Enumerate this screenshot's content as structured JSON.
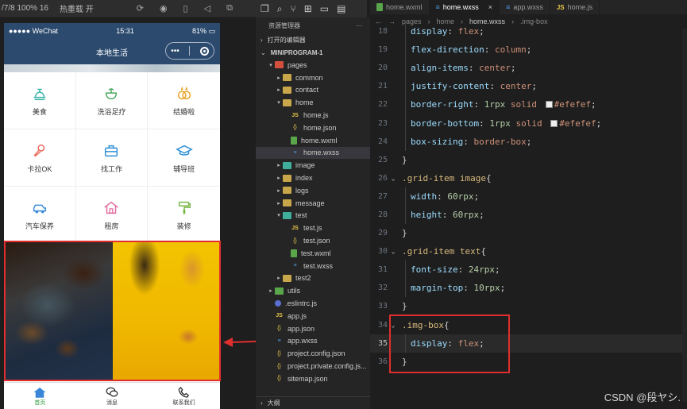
{
  "toolbar": {
    "device": "/7/8 100% 16",
    "hot_reload": "热重载 开"
  },
  "phone": {
    "status": {
      "carrier": "●●●●● WeChat",
      "time": "15:31",
      "battery": "81%"
    },
    "nav_title": "本地生活",
    "capsule_more": "•••",
    "grid": [
      {
        "label": "美食",
        "icon": "food-icon",
        "color": "#3cb4a8"
      },
      {
        "label": "洗浴足疗",
        "icon": "bath-icon",
        "color": "#4fa860"
      },
      {
        "label": "结婚啦",
        "icon": "rings-icon",
        "color": "#e8a428"
      },
      {
        "label": "卡拉OK",
        "icon": "microphone-icon",
        "color": "#e86a5a"
      },
      {
        "label": "找工作",
        "icon": "briefcase-icon",
        "color": "#2f8fd6"
      },
      {
        "label": "辅导班",
        "icon": "graduation-cap-icon",
        "color": "#2f8fd6"
      },
      {
        "label": "汽车保养",
        "icon": "car-icon",
        "color": "#3a8cd9"
      },
      {
        "label": "租房",
        "icon": "house-icon",
        "color": "#e26aa0"
      },
      {
        "label": "装修",
        "icon": "paint-roller-icon",
        "color": "#7ab648"
      }
    ],
    "tabs": [
      {
        "label": "首页",
        "icon": "home-icon",
        "active": true
      },
      {
        "label": "消息",
        "icon": "message-icon",
        "active": false
      },
      {
        "label": "联系我们",
        "icon": "phone-icon",
        "active": false
      }
    ]
  },
  "explorer": {
    "title": "资源管理器",
    "more": "···",
    "open_editors": "打开的编辑器",
    "project": "MINIPROGRAM-1",
    "outline": "大纲",
    "tree": [
      {
        "name": "pages",
        "depth": 1,
        "type": "folder-red",
        "chev": "▾"
      },
      {
        "name": "common",
        "depth": 2,
        "type": "folder",
        "chev": "▸"
      },
      {
        "name": "contact",
        "depth": 2,
        "type": "folder",
        "chev": "▸"
      },
      {
        "name": "home",
        "depth": 2,
        "type": "folder",
        "chev": "▾"
      },
      {
        "name": "home.js",
        "depth": 3,
        "type": "js",
        "chev": ""
      },
      {
        "name": "home.json",
        "depth": 3,
        "type": "json",
        "chev": ""
      },
      {
        "name": "home.wxml",
        "depth": 3,
        "type": "wxml",
        "chev": ""
      },
      {
        "name": "home.wxss",
        "depth": 3,
        "type": "wxss",
        "chev": "",
        "selected": true
      },
      {
        "name": "image",
        "depth": 2,
        "type": "folder-teal",
        "chev": "▸"
      },
      {
        "name": "index",
        "depth": 2,
        "type": "folder",
        "chev": "▸"
      },
      {
        "name": "logs",
        "depth": 2,
        "type": "folder",
        "chev": "▸"
      },
      {
        "name": "message",
        "depth": 2,
        "type": "folder",
        "chev": "▸"
      },
      {
        "name": "test",
        "depth": 2,
        "type": "folder-teal",
        "chev": "▾"
      },
      {
        "name": "test.js",
        "depth": 3,
        "type": "js",
        "chev": ""
      },
      {
        "name": "test.json",
        "depth": 3,
        "type": "json",
        "chev": ""
      },
      {
        "name": "test.wxml",
        "depth": 3,
        "type": "wxml",
        "chev": ""
      },
      {
        "name": "test.wxss",
        "depth": 3,
        "type": "wxss",
        "chev": ""
      },
      {
        "name": "test2",
        "depth": 2,
        "type": "folder",
        "chev": "▸"
      },
      {
        "name": "utils",
        "depth": 1,
        "type": "folder-green",
        "chev": "▸"
      },
      {
        "name": ".eslintrc.js",
        "depth": 1,
        "type": "rc",
        "chev": ""
      },
      {
        "name": "app.js",
        "depth": 1,
        "type": "js",
        "chev": ""
      },
      {
        "name": "app.json",
        "depth": 1,
        "type": "json",
        "chev": ""
      },
      {
        "name": "app.wxss",
        "depth": 1,
        "type": "wxss",
        "chev": ""
      },
      {
        "name": "project.config.json",
        "depth": 1,
        "type": "json",
        "chev": ""
      },
      {
        "name": "project.private.config.js...",
        "depth": 1,
        "type": "json",
        "chev": ""
      },
      {
        "name": "sitemap.json",
        "depth": 1,
        "type": "json",
        "chev": ""
      }
    ]
  },
  "editor": {
    "tabs": [
      {
        "name": "home.wxml",
        "type": "wxml",
        "active": false
      },
      {
        "name": "home.wxss",
        "type": "wxss",
        "active": true
      },
      {
        "name": "app.wxss",
        "type": "wxss",
        "active": false
      },
      {
        "name": "home.js",
        "type": "js",
        "active": false
      }
    ],
    "tab_close": "×",
    "breadcrumb": [
      "pages",
      "home",
      "home.wxss",
      ".img-box"
    ],
    "lines": [
      {
        "n": "18",
        "indent": true,
        "tokens": [
          [
            "prop",
            "display"
          ],
          [
            "punc",
            ": "
          ],
          [
            "val",
            "flex"
          ],
          [
            "punc",
            ";"
          ]
        ]
      },
      {
        "n": "19",
        "indent": true,
        "tokens": [
          [
            "prop",
            "flex-direction"
          ],
          [
            "punc",
            ": "
          ],
          [
            "val",
            "column"
          ],
          [
            "punc",
            ";"
          ]
        ]
      },
      {
        "n": "20",
        "indent": true,
        "tokens": [
          [
            "prop",
            "align-items"
          ],
          [
            "punc",
            ": "
          ],
          [
            "val",
            "center"
          ],
          [
            "punc",
            ";"
          ]
        ]
      },
      {
        "n": "21",
        "indent": true,
        "tokens": [
          [
            "prop",
            "justify-content"
          ],
          [
            "punc",
            ": "
          ],
          [
            "val",
            "center"
          ],
          [
            "punc",
            ";"
          ]
        ]
      },
      {
        "n": "22",
        "indent": true,
        "tokens": [
          [
            "prop",
            "border-right"
          ],
          [
            "punc",
            ": "
          ],
          [
            "num",
            "1rpx"
          ],
          [
            "val",
            " solid "
          ],
          [
            "swatch",
            ""
          ],
          [
            "color",
            "#efefef"
          ],
          [
            "punc",
            ";"
          ]
        ]
      },
      {
        "n": "23",
        "indent": true,
        "tokens": [
          [
            "prop",
            "border-bottom"
          ],
          [
            "punc",
            ": "
          ],
          [
            "num",
            "1rpx"
          ],
          [
            "val",
            " solid "
          ],
          [
            "swatch",
            ""
          ],
          [
            "color",
            "#efefef"
          ],
          [
            "punc",
            ";"
          ]
        ]
      },
      {
        "n": "24",
        "indent": true,
        "tokens": [
          [
            "prop",
            "box-sizing"
          ],
          [
            "punc",
            ": "
          ],
          [
            "val",
            "border-box"
          ],
          [
            "punc",
            ";"
          ]
        ]
      },
      {
        "n": "25",
        "indent": false,
        "tokens": [
          [
            "punc",
            "}"
          ]
        ]
      },
      {
        "n": "26",
        "indent": false,
        "fold": "⌄",
        "tokens": [
          [
            "sel",
            ".grid-item image"
          ],
          [
            "punc",
            "{"
          ]
        ]
      },
      {
        "n": "27",
        "indent": true,
        "tokens": [
          [
            "prop",
            "width"
          ],
          [
            "punc",
            ": "
          ],
          [
            "num",
            "60rpx"
          ],
          [
            "punc",
            ";"
          ]
        ]
      },
      {
        "n": "28",
        "indent": true,
        "tokens": [
          [
            "prop",
            "height"
          ],
          [
            "punc",
            ": "
          ],
          [
            "num",
            "60rpx"
          ],
          [
            "punc",
            ";"
          ]
        ]
      },
      {
        "n": "29",
        "indent": false,
        "tokens": [
          [
            "punc",
            "}"
          ]
        ]
      },
      {
        "n": "30",
        "indent": false,
        "fold": "⌄",
        "tokens": [
          [
            "sel",
            ".grid-item text"
          ],
          [
            "punc",
            "{"
          ]
        ]
      },
      {
        "n": "31",
        "indent": true,
        "tokens": [
          [
            "prop",
            "font-size"
          ],
          [
            "punc",
            ": "
          ],
          [
            "num",
            "24rpx"
          ],
          [
            "punc",
            ";"
          ]
        ]
      },
      {
        "n": "32",
        "indent": true,
        "tokens": [
          [
            "prop",
            "margin-top"
          ],
          [
            "punc",
            ": "
          ],
          [
            "num",
            "10rpx"
          ],
          [
            "punc",
            ";"
          ]
        ]
      },
      {
        "n": "33",
        "indent": false,
        "tokens": [
          [
            "punc",
            "}"
          ]
        ]
      },
      {
        "n": "34",
        "indent": false,
        "fold": "⌄",
        "tokens": [
          [
            "sel",
            ".img-box"
          ],
          [
            "punc",
            "{"
          ]
        ]
      },
      {
        "n": "35",
        "indent": true,
        "current": true,
        "tokens": [
          [
            "prop",
            "display"
          ],
          [
            "punc",
            ": "
          ],
          [
            "val",
            "flex"
          ],
          [
            "punc",
            ";"
          ]
        ]
      },
      {
        "n": "36",
        "indent": false,
        "tokens": [
          [
            "punc",
            "}"
          ]
        ]
      }
    ]
  },
  "watermark": "CSDN @段ヤシ."
}
